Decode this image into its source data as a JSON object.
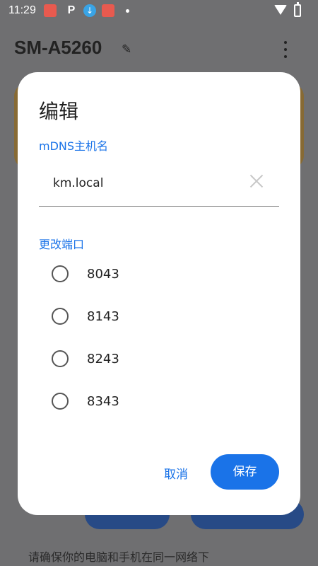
{
  "status_bar": {
    "time": "11:29",
    "icons": [
      "app-icon",
      "p-icon",
      "download-icon",
      "app-icon",
      "dot-icon",
      "wifi-icon",
      "battery-icon"
    ],
    "p_glyph": "P"
  },
  "background": {
    "app_title": "SM-A5260",
    "network_note": "请确保你的电脑和手机在同一网络下"
  },
  "dialog": {
    "title": "编辑",
    "mdns_label": "mDNS主机名",
    "hostname_value": "km.local",
    "port_label": "更改端口",
    "port_options": [
      "8043",
      "8143",
      "8243",
      "8343"
    ],
    "cancel_label": "取消",
    "save_label": "保存"
  },
  "colors": {
    "accent": "#1a73e8",
    "scrim": "#6f6f71"
  }
}
